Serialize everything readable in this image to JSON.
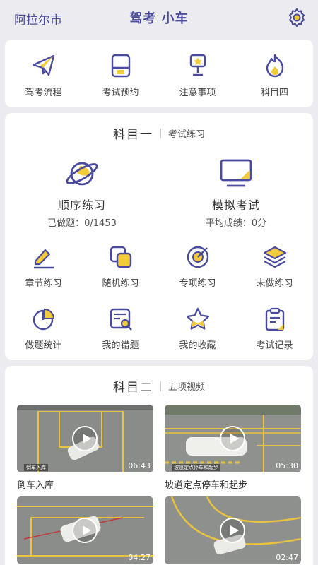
{
  "header": {
    "city": "阿拉尔市",
    "title": "驾考 小车"
  },
  "quick": [
    {
      "label": "驾考流程",
      "icon": "paper-plane-icon"
    },
    {
      "label": "考试预约",
      "icon": "calendar-card-icon"
    },
    {
      "label": "注意事项",
      "icon": "trophy-icon"
    },
    {
      "label": "科目四",
      "icon": "flame-icon"
    }
  ],
  "subject1": {
    "title": "科目一",
    "subtitle": "考试练习",
    "seq": {
      "label": "顺序练习",
      "sub": "已做题：0/1453"
    },
    "mock": {
      "label": "模拟考试",
      "sub": "平均成绩：0分"
    },
    "grid": [
      {
        "label": "章节练习",
        "icon": "edit-pen-icon"
      },
      {
        "label": "随机练习",
        "icon": "stacked-squares-icon"
      },
      {
        "label": "专项练习",
        "icon": "target-icon"
      },
      {
        "label": "未做练习",
        "icon": "layers-icon"
      },
      {
        "label": "做题统计",
        "icon": "pie-chart-icon"
      },
      {
        "label": "我的错题",
        "icon": "document-search-icon"
      },
      {
        "label": "我的收藏",
        "icon": "star-icon"
      },
      {
        "label": "考试记录",
        "icon": "clipboard-icon"
      }
    ]
  },
  "subject2": {
    "title": "科目二",
    "subtitle": "五项视频",
    "videos": [
      {
        "title": "倒车入库",
        "duration": "06:43",
        "caption": "倒车入库"
      },
      {
        "title": "坡道定点停车和起步",
        "duration": "05:30",
        "caption": "坡道定点停车和起步"
      },
      {
        "title": "",
        "duration": "04:27",
        "caption": ""
      },
      {
        "title": "",
        "duration": "02:47",
        "caption": ""
      }
    ]
  },
  "colors": {
    "accent": "#4a4a9e",
    "highlight": "#f2cb3a",
    "background": "#ececf0"
  }
}
